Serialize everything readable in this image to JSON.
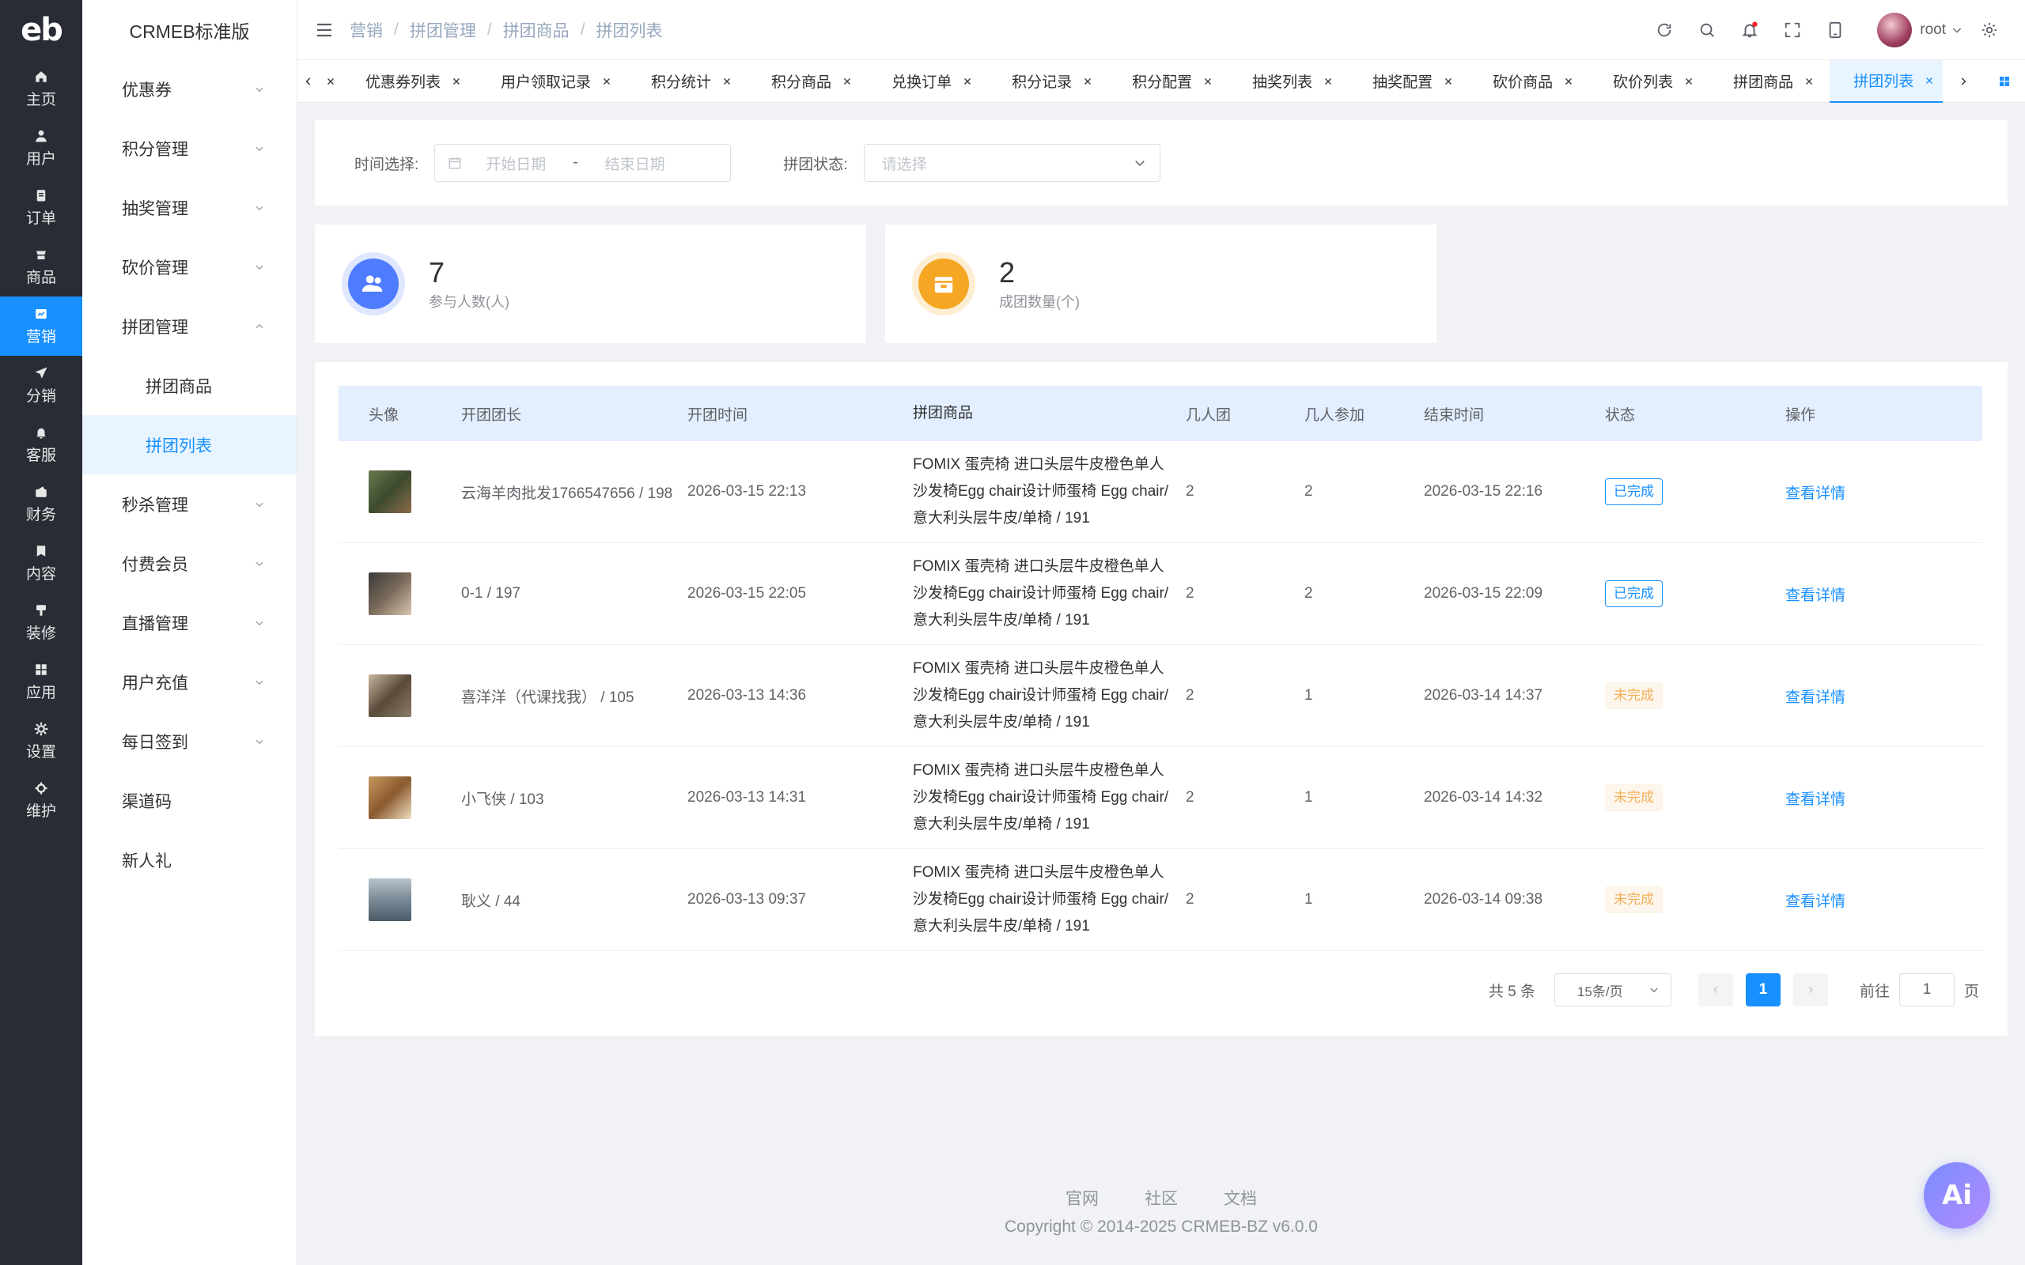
{
  "rail": {
    "logo": "eb",
    "items": [
      {
        "label": "主页",
        "icon": "home-icon"
      },
      {
        "label": "用户",
        "icon": "user-icon"
      },
      {
        "label": "订单",
        "icon": "order-icon"
      },
      {
        "label": "商品",
        "icon": "product-icon"
      },
      {
        "label": "营销",
        "icon": "marketing-icon",
        "active": true
      },
      {
        "label": "分销",
        "icon": "distribution-icon"
      },
      {
        "label": "客服",
        "icon": "service-icon"
      },
      {
        "label": "财务",
        "icon": "finance-icon"
      },
      {
        "label": "内容",
        "icon": "content-icon"
      },
      {
        "label": "装修",
        "icon": "decoration-icon"
      },
      {
        "label": "应用",
        "icon": "apps-icon"
      },
      {
        "label": "设置",
        "icon": "settings-icon"
      },
      {
        "label": "维护",
        "icon": "maintenance-icon"
      }
    ]
  },
  "sidebar": {
    "brand": "CRMEB标准版",
    "groups": [
      "优惠券",
      "积分管理",
      "抽奖管理",
      "砍价管理",
      "拼团管理"
    ],
    "sub": [
      "拼团商品",
      "拼团列表"
    ],
    "groups2": [
      "秒杀管理",
      "付费会员",
      "直播管理",
      "用户充值",
      "每日签到"
    ],
    "plain": [
      "渠道码",
      "新人礼"
    ]
  },
  "header": {
    "breadcrumb": [
      "营销",
      "拼团管理",
      "拼团商品",
      "拼团列表"
    ],
    "username": "root"
  },
  "tabs": [
    "优惠券列表",
    "用户领取记录",
    "积分统计",
    "积分商品",
    "兑换订单",
    "积分记录",
    "积分配置",
    "抽奖列表",
    "抽奖配置",
    "砍价商品",
    "砍价列表",
    "拼团商品",
    "拼团列表"
  ],
  "filter": {
    "time_label": "时间选择:",
    "start_placeholder": "开始日期",
    "dash": "-",
    "end_placeholder": "结束日期",
    "status_label": "拼团状态:",
    "status_placeholder": "请选择"
  },
  "stats": [
    {
      "value": "7",
      "label": "参与人数(人)",
      "color": "#4f7cff"
    },
    {
      "value": "2",
      "label": "成团数量(个)",
      "color": "#f5a623"
    }
  ],
  "table": {
    "headers": [
      "头像",
      "开团团长",
      "开团时间",
      "拼团商品",
      "几人团",
      "几人参加",
      "结束时间",
      "状态",
      "操作"
    ],
    "rows": [
      {
        "leader": "云海羊肉批发1766547656 / 198",
        "time": "2026-03-15 22:13",
        "product": [
          "FOMIX 蛋壳椅 进口头层牛皮橙色单人",
          "沙发椅Egg chair设计师蛋椅 Egg chair/",
          "意大利头层牛皮/单椅 / 191"
        ],
        "size": "2",
        "joined": "2",
        "end": "2026-03-15 22:16",
        "status": "已完成",
        "done": true,
        "action": "查看详情"
      },
      {
        "leader": "0-1 / 197",
        "time": "2026-03-15 22:05",
        "product": [
          "FOMIX 蛋壳椅 进口头层牛皮橙色单人",
          "沙发椅Egg chair设计师蛋椅 Egg chair/",
          "意大利头层牛皮/单椅 / 191"
        ],
        "size": "2",
        "joined": "2",
        "end": "2026-03-15 22:09",
        "status": "已完成",
        "done": true,
        "action": "查看详情"
      },
      {
        "leader": "喜洋洋（代课找我） / 105",
        "time": "2026-03-13 14:36",
        "product": [
          "FOMIX 蛋壳椅 进口头层牛皮橙色单人",
          "沙发椅Egg chair设计师蛋椅 Egg chair/",
          "意大利头层牛皮/单椅 / 191"
        ],
        "size": "2",
        "joined": "1",
        "end": "2026-03-14 14:37",
        "status": "未完成",
        "done": false,
        "action": "查看详情"
      },
      {
        "leader": "小飞侠 / 103",
        "time": "2026-03-13 14:31",
        "product": [
          "FOMIX 蛋壳椅 进口头层牛皮橙色单人",
          "沙发椅Egg chair设计师蛋椅 Egg chair/",
          "意大利头层牛皮/单椅 / 191"
        ],
        "size": "2",
        "joined": "1",
        "end": "2026-03-14 14:32",
        "status": "未完成",
        "done": false,
        "action": "查看详情"
      },
      {
        "leader": "耿义 / 44",
        "time": "2026-03-13 09:37",
        "product": [
          "FOMIX 蛋壳椅 进口头层牛皮橙色单人",
          "沙发椅Egg chair设计师蛋椅 Egg chair/",
          "意大利头层牛皮/单椅 / 191"
        ],
        "size": "2",
        "joined": "1",
        "end": "2026-03-14 09:38",
        "status": "未完成",
        "done": false,
        "action": "查看详情"
      }
    ]
  },
  "pagination": {
    "total": "共 5 条",
    "page_size": "15条/页",
    "current": "1",
    "goto_label": "前往",
    "goto_value": "1",
    "page_suffix": "页"
  },
  "footer": {
    "links": [
      "官网",
      "社区",
      "文档"
    ],
    "copyright": "Copyright © 2014-2025 CRMEB-BZ v6.0.0"
  },
  "ai_button": "Ai",
  "colors": {
    "primary": "#1890ff",
    "rail_bg": "#282c34"
  }
}
